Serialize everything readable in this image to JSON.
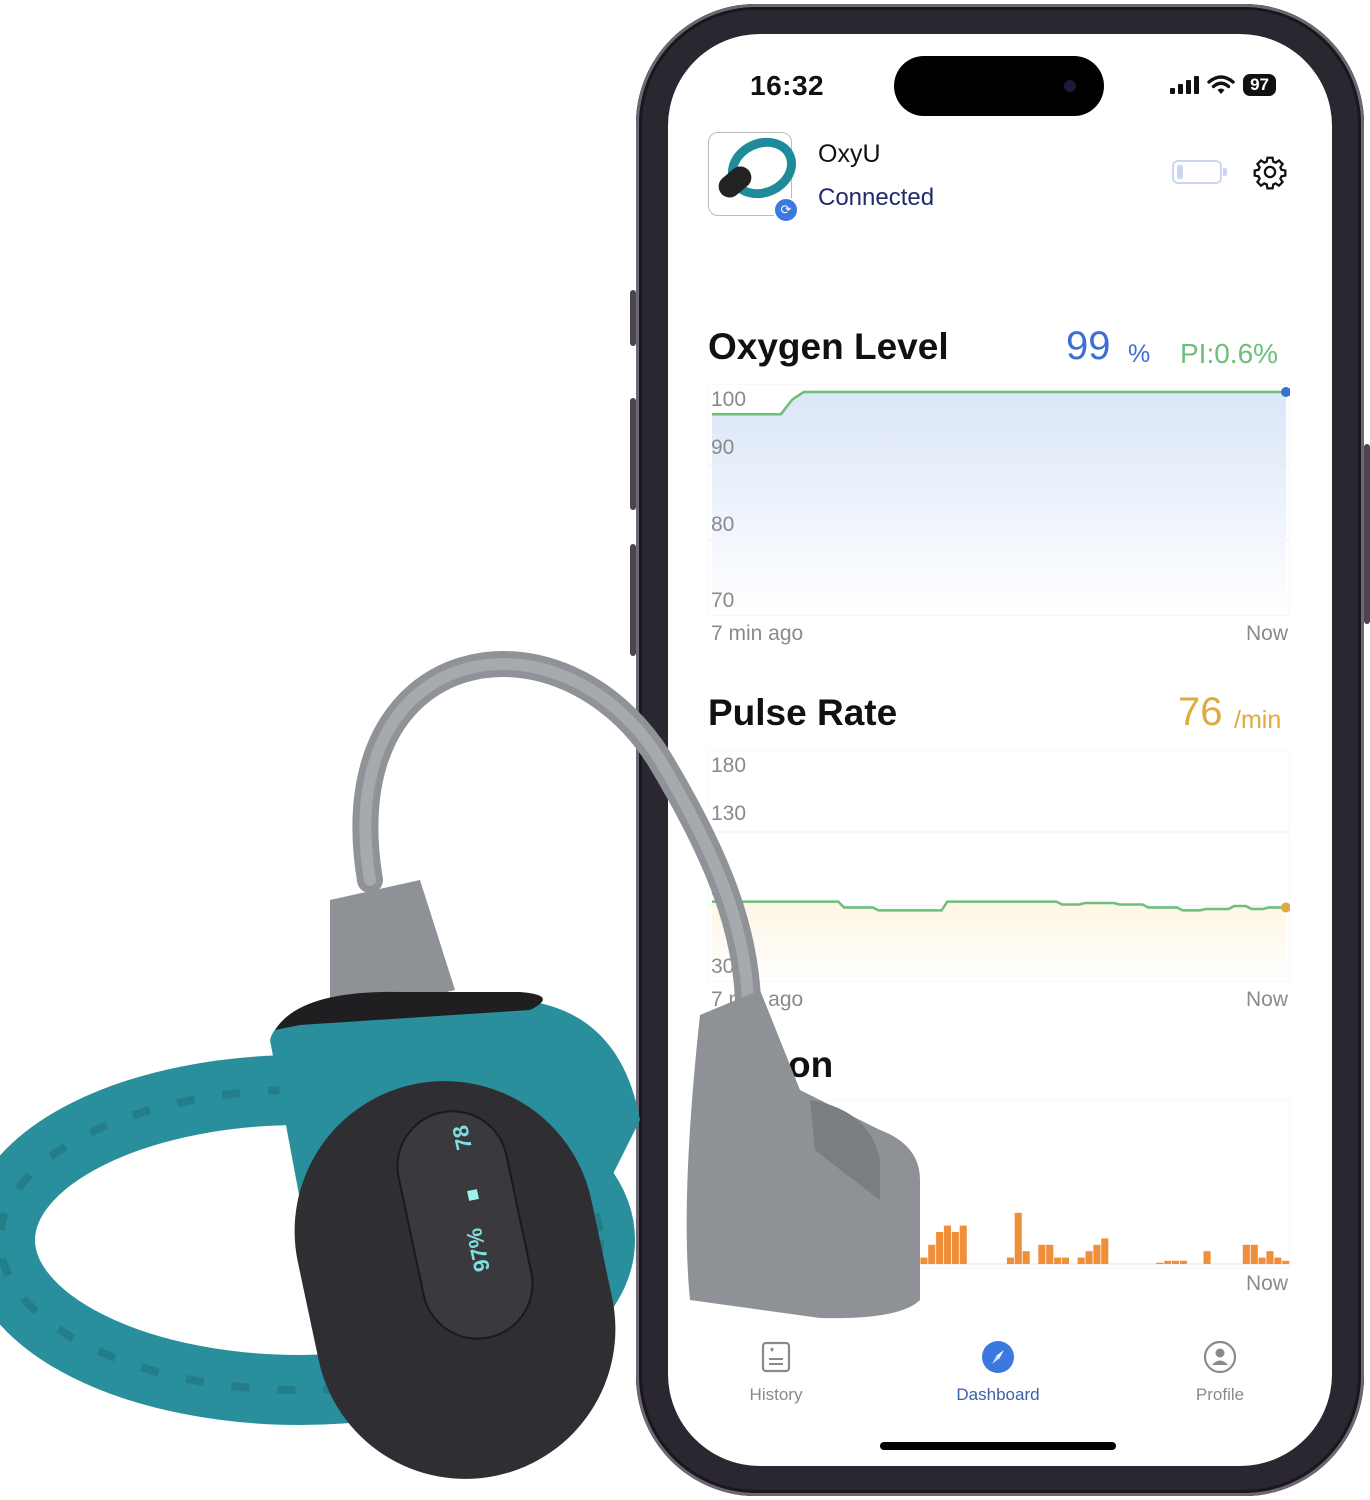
{
  "status_bar": {
    "time": "16:32",
    "battery": "97"
  },
  "header": {
    "device_name": "OxyU",
    "connection_status": "Connected",
    "icons": {
      "device_thumbnail": "wristband-oximeter-image",
      "sync": "sync-icon",
      "battery": "battery-low-icon",
      "settings": "gear-icon"
    }
  },
  "oxygen": {
    "title": "Oxygen Level",
    "value": "99",
    "unit": "%",
    "pi": "PI:0.6%",
    "colors": {
      "value": "#3b6fd4",
      "pi": "#6cc07a",
      "line": "#6cc07a",
      "fill": "#dbe6f8",
      "dot": "#3b6fd4"
    }
  },
  "pulse": {
    "title": "Pulse Rate",
    "value": "76",
    "unit": "/min",
    "colors": {
      "value": "#e0aa3e",
      "line": "#6cc07a",
      "fill": "#fff6e4",
      "dot": "#e0aa3e"
    }
  },
  "motion": {
    "title_visible": "on",
    "x_right": "Now",
    "colors": {
      "bars": "#ef8f3a"
    }
  },
  "chart_data": [
    {
      "type": "line",
      "title": "Oxygen Level",
      "yticks": [
        "100",
        "90",
        "80",
        "70"
      ],
      "ylim": [
        70,
        100
      ],
      "x_labels": [
        "7 min ago",
        "Now"
      ],
      "x": [
        0,
        0.12,
        0.13,
        0.14,
        0.15,
        0.16,
        1.0
      ],
      "y": [
        97,
        97,
        98,
        99,
        99.5,
        100,
        100
      ]
    },
    {
      "type": "line",
      "title": "Pulse Rate",
      "yticks": [
        "180",
        "130",
        "80",
        "30"
      ],
      "ylim": [
        30,
        180
      ],
      "x_labels": [
        "7 min ago",
        "Now"
      ],
      "x": [
        0,
        0.22,
        0.23,
        0.28,
        0.29,
        0.4,
        0.41,
        0.6,
        0.61,
        0.64,
        0.65,
        0.7,
        0.71,
        0.75,
        0.76,
        0.81,
        0.82,
        0.85,
        0.86,
        0.9,
        0.91,
        0.93,
        0.94,
        0.96,
        0.97,
        1.0
      ],
      "y": [
        83,
        83,
        79,
        79,
        77,
        77,
        83,
        83,
        81,
        81,
        82,
        82,
        81,
        81,
        79,
        79,
        77,
        77,
        78,
        78,
        80,
        80,
        78,
        78,
        79,
        79
      ]
    },
    {
      "type": "bar",
      "title": "Motion",
      "x_labels": [
        "Now"
      ],
      "values": [
        0,
        0,
        0,
        0,
        0,
        0,
        0,
        0,
        0,
        0,
        0,
        0,
        3,
        1,
        2,
        2,
        1,
        1,
        3,
        2,
        2,
        1,
        1,
        2,
        1,
        0,
        0,
        1,
        3,
        5,
        6,
        5,
        6,
        0,
        0,
        0,
        0,
        0,
        1,
        8,
        2,
        0,
        3,
        3,
        1,
        1,
        0,
        1,
        2,
        3,
        4,
        0,
        0,
        0,
        0,
        0,
        0,
        0.2,
        0.5,
        0.5,
        0.5,
        0,
        0,
        2,
        0,
        0,
        0,
        0,
        3,
        3,
        1,
        2,
        1,
        0.5
      ],
      "ylim": [
        0,
        25
      ]
    }
  ],
  "bottom_nav": {
    "items": [
      {
        "label": "History",
        "icon": "history-report-icon",
        "active": false
      },
      {
        "label": "Dashboard",
        "icon": "dashboard-compass-icon",
        "active": true
      },
      {
        "label": "Profile",
        "icon": "profile-person-icon",
        "active": false
      }
    ],
    "active_color": "#3b78e0",
    "inactive_color": "#8a8a8a"
  },
  "product": {
    "device_display": {
      "pulse": "78",
      "spo2": "97%"
    },
    "band_color": "#2a8f9c",
    "body_color": "#2f2f33"
  }
}
